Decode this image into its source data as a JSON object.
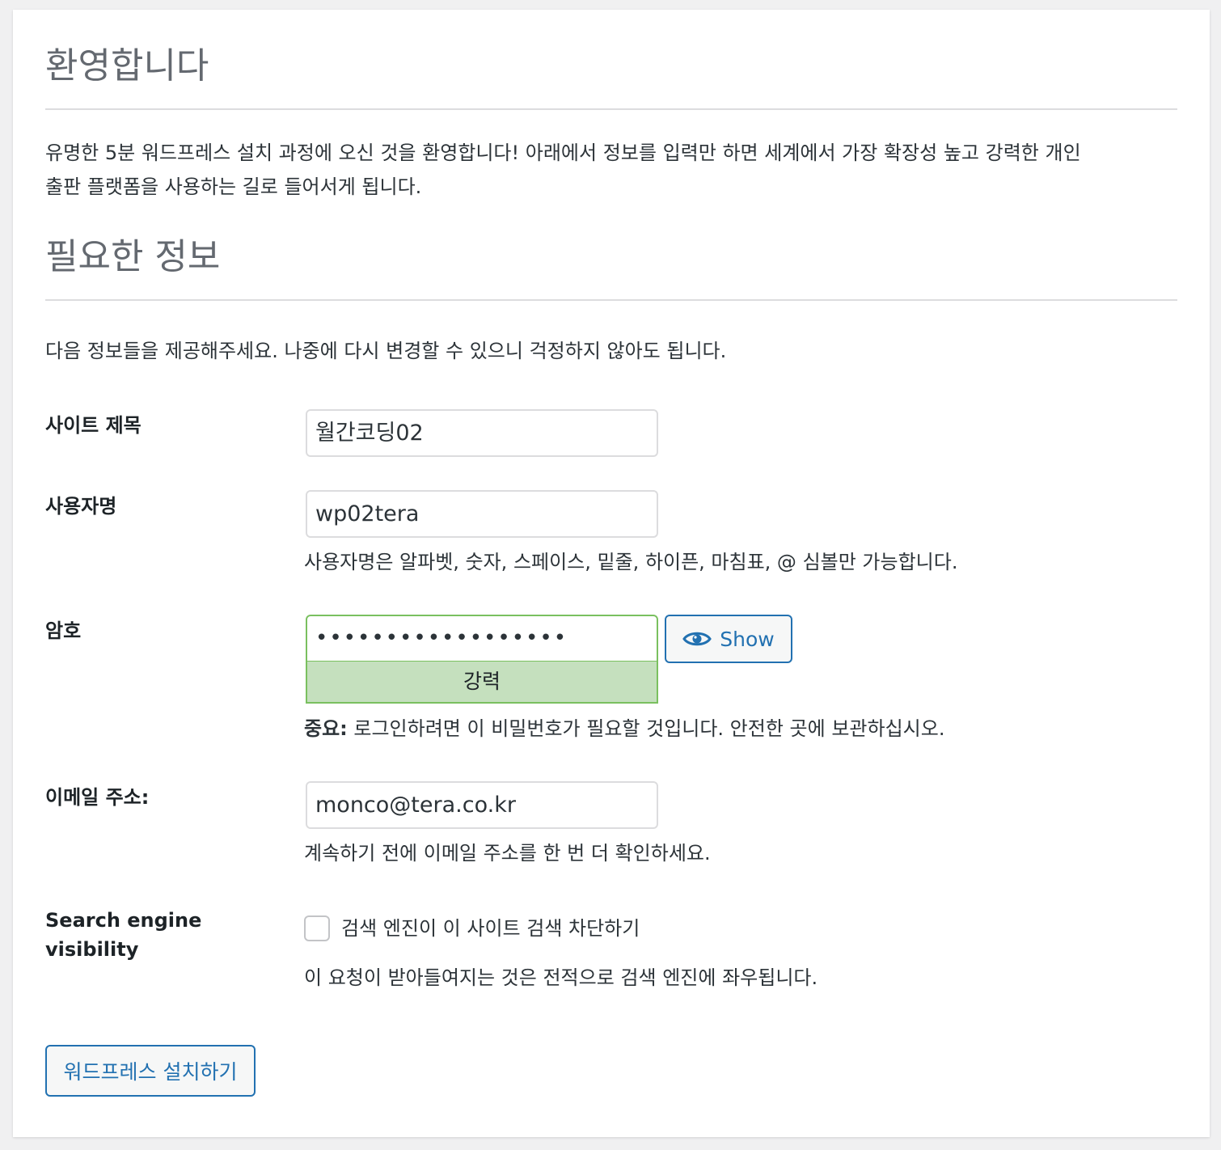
{
  "welcome": {
    "title": "환영합니다",
    "line1": "유명한 5분 워드프레스 설치 과정에 오신 것을 환영합니다! 아래에서 정보를 입력만 하면 세계에서 가장 확장성 높고 강력한 개인",
    "line2": "출판 플랫폼을 사용하는 길로 들어서게 됩니다."
  },
  "required": {
    "title": "필요한 정보",
    "intro": "다음 정보들을 제공해주세요. 나중에 다시 변경할 수 있으니 걱정하지 않아도 됩니다."
  },
  "form": {
    "site_title": {
      "label": "사이트 제목",
      "value": "월간코딩02"
    },
    "username": {
      "label": "사용자명",
      "value": "wp02tera",
      "hint": "사용자명은 알파벳, 숫자, 스페이스, 밑줄, 하이픈, 마침표, @ 심볼만 가능합니다."
    },
    "password": {
      "label": "암호",
      "masked_value": "••••••••••••••••••",
      "show_label": "Show",
      "strength": "강력",
      "note_prefix": "중요:",
      "note": " 로그인하려면 이 비밀번호가 필요할 것입니다. 안전한 곳에 보관하십시오."
    },
    "email": {
      "label": "이메일 주소:",
      "value": "monco@tera.co.kr",
      "hint": "계속하기 전에 이메일 주소를 한 번 더 확인하세요."
    },
    "search_visibility": {
      "label_line1": "Search engine",
      "label_line2": "visibility",
      "checkbox_label": "검색 엔진이 이 사이트 검색 차단하기",
      "checked": false,
      "hint": "이 요청이 받아들여지는 것은 전적으로 검색 엔진에 좌우됩니다."
    },
    "submit_label": "워드프레스 설치하기"
  },
  "colors": {
    "accent": "#2271b1",
    "strength_bg": "#c5e0be",
    "strength_border": "#7ac05f"
  },
  "icons": {
    "show": "eye-icon"
  }
}
